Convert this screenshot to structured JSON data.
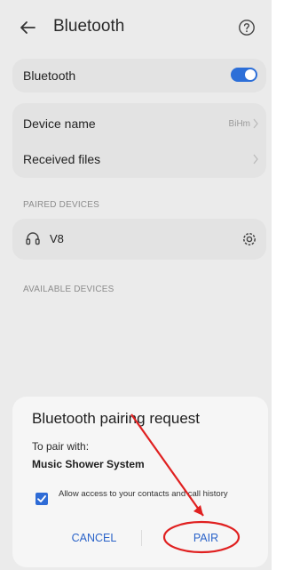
{
  "header": {
    "title": "Bluetooth",
    "back_icon": "arrow-left-icon",
    "help_icon": "question-circle-icon"
  },
  "bluetooth_toggle": {
    "label": "Bluetooth",
    "enabled": true,
    "color": "#2d6fd8"
  },
  "settings": {
    "device_name_label": "Device name",
    "device_name_value": "BiHm",
    "received_files_label": "Received files"
  },
  "paired": {
    "section_label": "PAIRED DEVICES",
    "device_name": "V8",
    "device_icon": "headphones-icon",
    "settings_icon": "gear-icon"
  },
  "available": {
    "section_label": "AVAILABLE DEVICES"
  },
  "dialog": {
    "title": "Bluetooth pairing request",
    "subtitle": "To pair with:",
    "device": "Music Shower System",
    "checkbox_checked": true,
    "checkbox_label": "Allow access to your contacts and call history",
    "cancel_label": "CANCEL",
    "pair_label": "PAIR",
    "accent_color": "#2a63c9",
    "annotation_color": "#e02020"
  }
}
